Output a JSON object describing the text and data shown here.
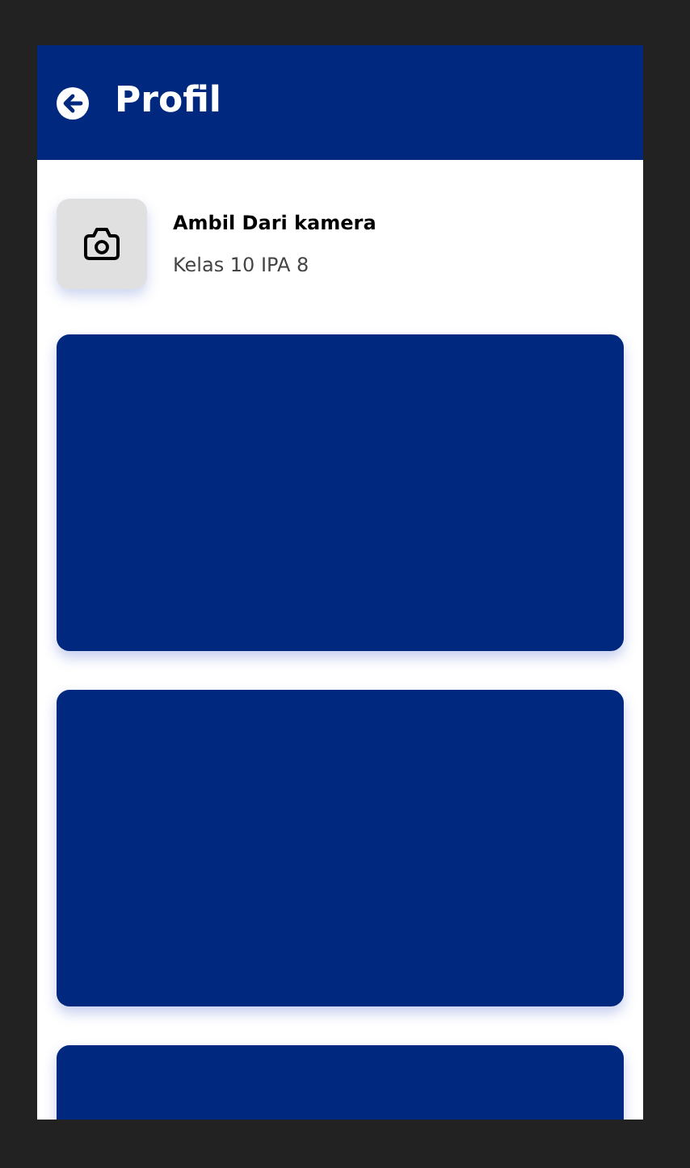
{
  "header": {
    "title": "Profil"
  },
  "profile": {
    "name": "Ambil Dari kamera",
    "class": "Kelas 10 IPA 8"
  },
  "cards": [
    {
      "kind": "panel"
    },
    {
      "kind": "panel"
    },
    {
      "kind": "panel"
    }
  ]
}
